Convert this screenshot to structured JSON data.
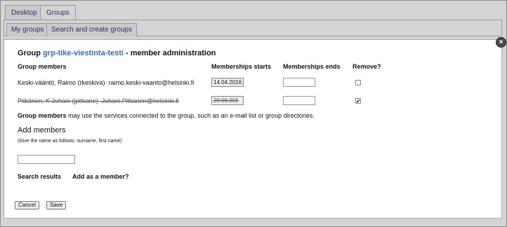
{
  "tabs": [
    {
      "label": "Desktop"
    },
    {
      "label": "Groups"
    }
  ],
  "subtabs": [
    {
      "label": "My groups"
    },
    {
      "label": "Search and create groups"
    }
  ],
  "dialog": {
    "close_glyph": "×",
    "title_prefix": "Group",
    "group_name": "grp-tike-viestinta-testi",
    "title_suffix": "- member administration",
    "headers": {
      "members": "Group members",
      "starts": "Memberships starts",
      "ends": "Memberships ends",
      "remove": "Remove?"
    },
    "members": [
      {
        "name": "Keski-vääntö, Raimo (rkeskiva)",
        "email": "raimo.keski-vaanto@helsinki.fi",
        "start": "14.04.2016",
        "end": "",
        "remove": "",
        "removed": false
      },
      {
        "name": "Pitkänen, K Juhani (jpitkane)",
        "email": "Juhani.Pitkanen@helsinki.fi",
        "start": "20.06.201",
        "end": "",
        "remove": "✔",
        "removed": true
      }
    ],
    "info_bold": "Group members",
    "info_rest": " may use the services connected to the group, such as an e-mail list or group directories.",
    "add_members_heading": "Add members",
    "add_members_hint": "(Give the name as follows: surname, first name)",
    "search_results_label": "Search results",
    "add_as_member_label": "Add as a member?",
    "cancel_label": "Cancel",
    "save_label": "Save"
  },
  "icons": {
    "close": "close-icon",
    "checkbox": "checkbox-icon"
  },
  "colors": {
    "group_name": "#2a6ecf",
    "tab_text": "#2d2d6b"
  }
}
